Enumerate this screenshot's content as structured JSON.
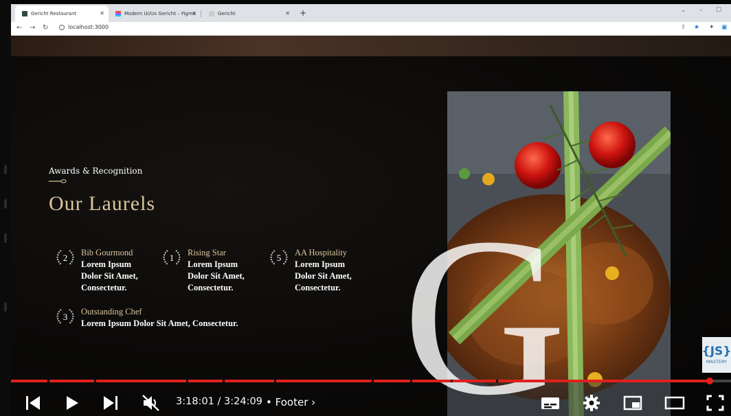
{
  "browser": {
    "tabs": [
      {
        "title": "Gericht Restaurant",
        "active": true
      },
      {
        "title": "Modern Ui/Ux Gericht – Figma",
        "active": false
      },
      {
        "title": "Gericht",
        "active": false
      }
    ],
    "url": "localhost:3000"
  },
  "page": {
    "subtitle": "Awards & Recognition",
    "heading": "Our Laurels",
    "big_letter": "G",
    "laurels": [
      {
        "number": "2",
        "title": "Bib Gourmond",
        "description": "Lorem Ipsum Dolor Sit Amet, Consectetur."
      },
      {
        "number": "1",
        "title": "Rising Star",
        "description": "Lorem Ipsum Dolor Sit Amet, Consectetur."
      },
      {
        "number": "5",
        "title": "AA Hospitality",
        "description": "Lorem Ipsum Dolor Sit Amet, Consectetur."
      },
      {
        "number": "3",
        "title": "Outstanding Chef",
        "description": "Lorem Ipsum Dolor Sit Amet, Consectetur."
      }
    ]
  },
  "player": {
    "current_time": "3:18:01",
    "duration": "3:24:09",
    "time_separator": " / ",
    "chapter": "Footer",
    "progress_fraction": 0.97,
    "accent": "#e0201e",
    "icons": [
      "previous-icon",
      "play-icon",
      "next-icon",
      "mute-icon",
      "subtitles-icon",
      "settings-icon",
      "miniplayer-icon",
      "theater-icon",
      "fullscreen-icon"
    ]
  },
  "colors": {
    "gold": "#dcc59d",
    "background": "#0a0908"
  }
}
